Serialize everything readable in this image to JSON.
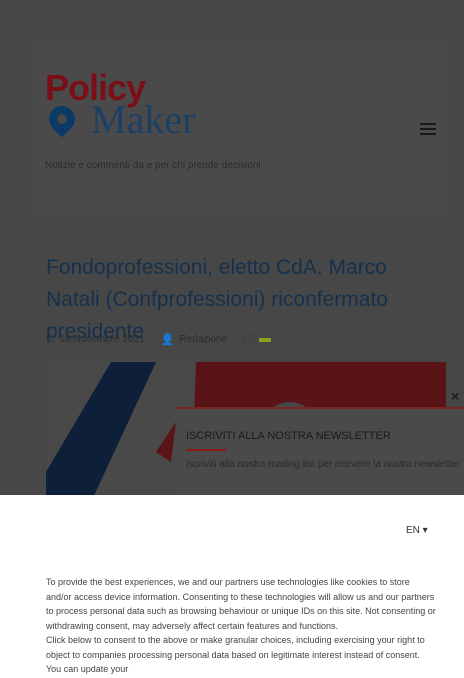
{
  "site": {
    "logo_top": "Policy",
    "logo_bottom": "Maker",
    "tagline": "Notizie e commenti da e per chi prende decisioni"
  },
  "article": {
    "title": "Fondoprofessioni, eletto CdA. Marco Natali (Confprofessioni) riconfermato presidente",
    "date": "18 Novembre 2021",
    "author": "Redazione",
    "category": ""
  },
  "newsletter": {
    "title": "ISCRIVITI ALLA NOSTRA NEWSLETTER",
    "description": "Iscriviti alla nostra mailing list per ricevere la nostra newsletter",
    "close": "×"
  },
  "consent": {
    "language": "EN ▾",
    "paragraph1": "To provide the best experiences, we and our partners use technologies like cookies to store and/or access device information. Consenting to these technologies will allow us and our partners to process personal data such as browsing behaviour or unique IDs on this site. Not consenting or withdrawing consent, may adversely affect certain features and functions.",
    "paragraph2": "Click below to consent to the above or make granular choices, including exercising your right to object to companies processing personal data based on legitimate interest instead of consent. You can update your"
  },
  "icons": [
    "clock-icon",
    "user-icon",
    "folder-icon",
    "menu-icon",
    "close-icon",
    "location-pin-icon"
  ],
  "colors": {
    "overlay": "#474747",
    "logo_red": "#7a0f18",
    "logo_blue": "#1c3f66",
    "title_blue": "#15314d",
    "newsletter_border": "#7a2620",
    "category_green": "#8a9f1a"
  }
}
